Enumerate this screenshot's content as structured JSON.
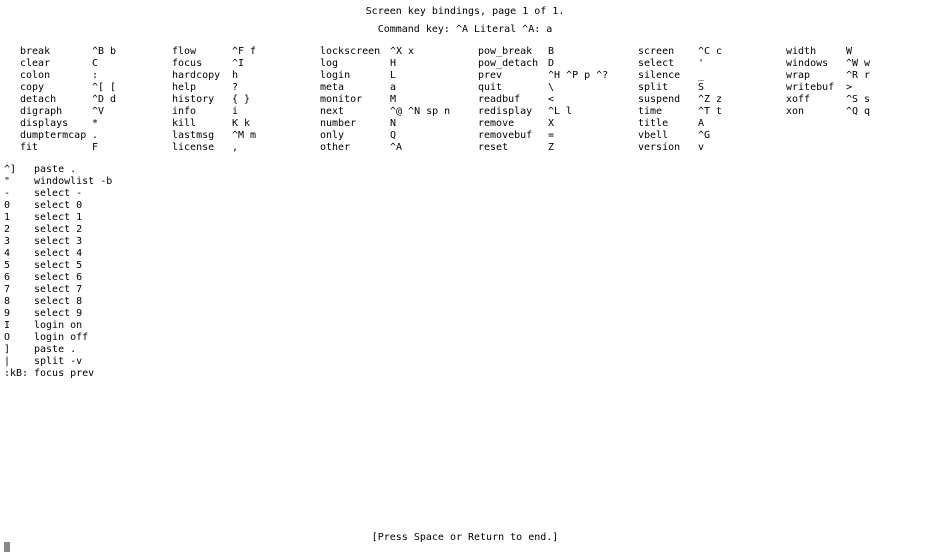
{
  "header": {
    "title": "Screen key bindings, page 1 of 1.",
    "subtitle": "Command key:  ^A   Literal ^A:  a"
  },
  "columns": [
    [
      {
        "cmd": "break",
        "key": "^B b"
      },
      {
        "cmd": "clear",
        "key": "C"
      },
      {
        "cmd": "colon",
        "key": ":"
      },
      {
        "cmd": "copy",
        "key": "^[ ["
      },
      {
        "cmd": "detach",
        "key": "^D d"
      },
      {
        "cmd": "digraph",
        "key": "^V"
      },
      {
        "cmd": "displays",
        "key": "*"
      },
      {
        "cmd": "dumptermcap",
        "key": "."
      },
      {
        "cmd": "fit",
        "key": "F"
      }
    ],
    [
      {
        "cmd": "flow",
        "key": "^F f"
      },
      {
        "cmd": "focus",
        "key": "^I"
      },
      {
        "cmd": "hardcopy",
        "key": "h"
      },
      {
        "cmd": "help",
        "key": "?"
      },
      {
        "cmd": "history",
        "key": "{ }"
      },
      {
        "cmd": "info",
        "key": "i"
      },
      {
        "cmd": "kill",
        "key": "K k"
      },
      {
        "cmd": "lastmsg",
        "key": "^M m"
      },
      {
        "cmd": "license",
        "key": ","
      }
    ],
    [
      {
        "cmd": "lockscreen",
        "key": "^X x"
      },
      {
        "cmd": "log",
        "key": "H"
      },
      {
        "cmd": "login",
        "key": "L"
      },
      {
        "cmd": "meta",
        "key": "a"
      },
      {
        "cmd": "monitor",
        "key": "M"
      },
      {
        "cmd": "next",
        "key": "^@ ^N sp n"
      },
      {
        "cmd": "number",
        "key": "N"
      },
      {
        "cmd": "only",
        "key": "Q"
      },
      {
        "cmd": "other",
        "key": "^A"
      }
    ],
    [
      {
        "cmd": "pow_break",
        "key": "B"
      },
      {
        "cmd": "pow_detach",
        "key": "D"
      },
      {
        "cmd": "prev",
        "key": "^H ^P p ^?"
      },
      {
        "cmd": "quit",
        "key": "\\"
      },
      {
        "cmd": "readbuf",
        "key": "<"
      },
      {
        "cmd": "redisplay",
        "key": "^L l"
      },
      {
        "cmd": "remove",
        "key": "X"
      },
      {
        "cmd": "removebuf",
        "key": "="
      },
      {
        "cmd": "reset",
        "key": "Z"
      }
    ],
    [
      {
        "cmd": "screen",
        "key": "^C c"
      },
      {
        "cmd": "select",
        "key": "'"
      },
      {
        "cmd": "silence",
        "key": "_"
      },
      {
        "cmd": "split",
        "key": "S"
      },
      {
        "cmd": "suspend",
        "key": "^Z z"
      },
      {
        "cmd": "time",
        "key": "^T t"
      },
      {
        "cmd": "title",
        "key": "A"
      },
      {
        "cmd": "vbell",
        "key": "^G"
      },
      {
        "cmd": "version",
        "key": "v"
      }
    ],
    [
      {
        "cmd": "width",
        "key": "W"
      },
      {
        "cmd": "windows",
        "key": "^W w"
      },
      {
        "cmd": "wrap",
        "key": "^R r"
      },
      {
        "cmd": "writebuf",
        "key": ">"
      },
      {
        "cmd": "xoff",
        "key": "^S s"
      },
      {
        "cmd": "xon",
        "key": "^Q q"
      }
    ]
  ],
  "extras": [
    {
      "key": "^]",
      "cmd": "paste ."
    },
    {
      "key": "\"",
      "cmd": "windowlist -b"
    },
    {
      "key": "-",
      "cmd": "select -"
    },
    {
      "key": "0",
      "cmd": "select 0"
    },
    {
      "key": "1",
      "cmd": "select 1"
    },
    {
      "key": "2",
      "cmd": "select 2"
    },
    {
      "key": "3",
      "cmd": "select 3"
    },
    {
      "key": "4",
      "cmd": "select 4"
    },
    {
      "key": "5",
      "cmd": "select 5"
    },
    {
      "key": "6",
      "cmd": "select 6"
    },
    {
      "key": "7",
      "cmd": "select 7"
    },
    {
      "key": "8",
      "cmd": "select 8"
    },
    {
      "key": "9",
      "cmd": "select 9"
    },
    {
      "key": "I",
      "cmd": "login on"
    },
    {
      "key": "O",
      "cmd": "login off"
    },
    {
      "key": "]",
      "cmd": "paste ."
    },
    {
      "key": "|",
      "cmd": "split -v"
    },
    {
      "key": ":kB:",
      "cmd": "focus prev"
    }
  ],
  "footer": {
    "prompt": "[Press Space or Return to end.]"
  }
}
